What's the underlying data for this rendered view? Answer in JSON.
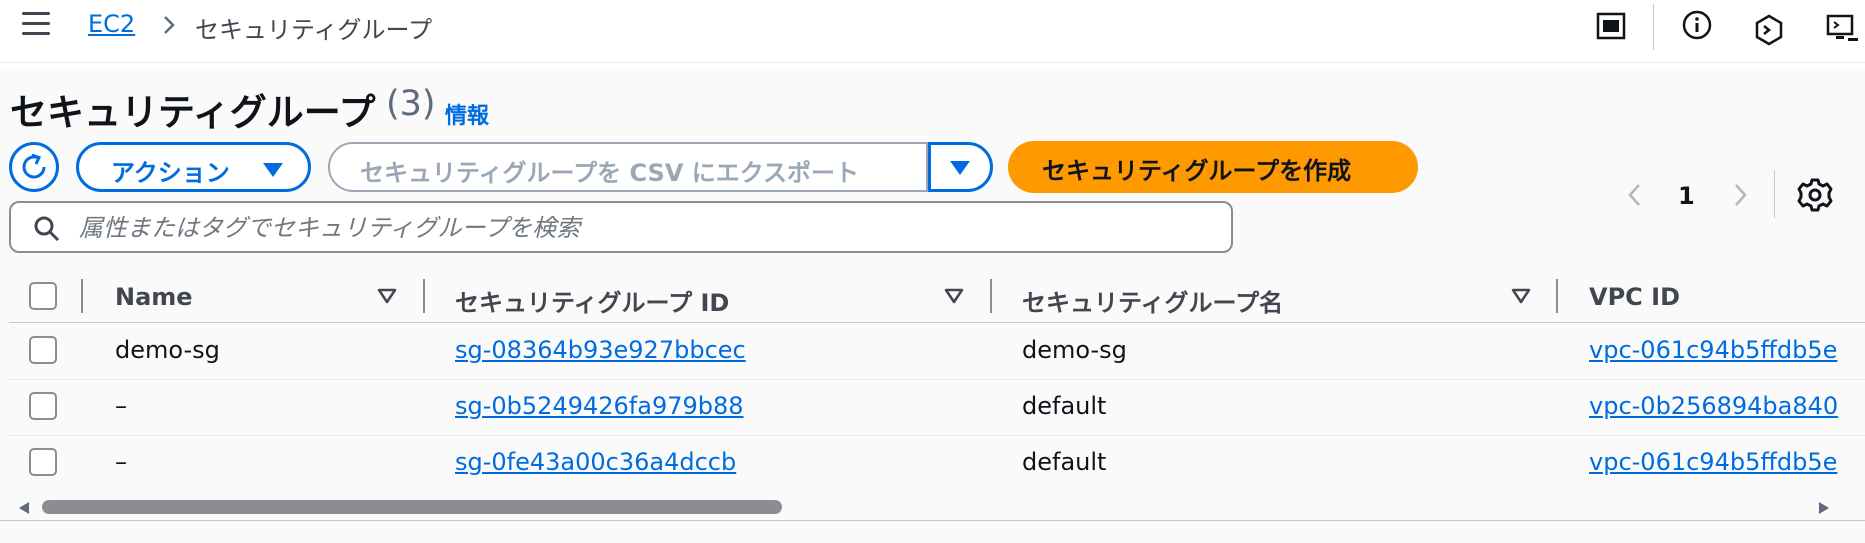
{
  "breadcrumb": {
    "root": "EC2",
    "current": "セキュリティグループ"
  },
  "top_icons": [
    "panel-icon",
    "info-icon",
    "cloudshell-icon",
    "remote-access-icon"
  ],
  "header": {
    "title": "セキュリティグループ",
    "count": "(3)",
    "info_link": "情報"
  },
  "toolbar": {
    "actions_label": "アクション",
    "export_label": "セキュリティグループを CSV にエクスポート",
    "create_label": "セキュリティグループを作成"
  },
  "search": {
    "placeholder": "属性またはタグでセキュリティグループを検索"
  },
  "pagination": {
    "current_page": "1"
  },
  "table": {
    "columns": [
      "Name",
      "セキュリティグループ ID",
      "セキュリティグループ名",
      "VPC ID"
    ],
    "rows": [
      {
        "name": "demo-sg",
        "sg_id": "sg-08364b93e927bbcec",
        "sg_name": "demo-sg",
        "vpc_id": "vpc-061c94b5ffdb5e"
      },
      {
        "name": "–",
        "sg_id": "sg-0b5249426fa979b88",
        "sg_name": "default",
        "vpc_id": "vpc-0b256894ba840"
      },
      {
        "name": "–",
        "sg_id": "sg-0fe43a00c36a4dccb",
        "sg_name": "default",
        "vpc_id": "vpc-061c94b5ffdb5e"
      }
    ]
  },
  "colors": {
    "link": "#006ce0",
    "primary_button": "#ff9900",
    "text": "#0f141a",
    "border": "#8c8c94"
  }
}
